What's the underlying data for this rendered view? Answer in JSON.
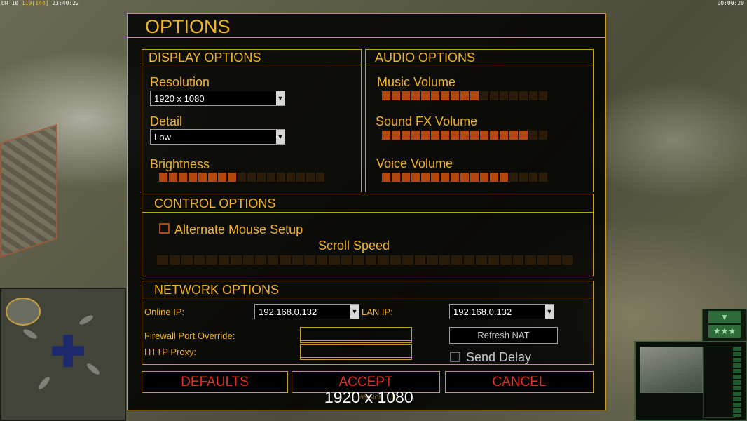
{
  "hud": {
    "top_left_a": "UR 10",
    "top_left_b": "119",
    "top_left_c": "[144]",
    "top_left_time": "23:40:22",
    "top_right_time": "00:00:20"
  },
  "colors": {
    "accent": "#f2b320",
    "border": "#c89a2a",
    "slider_on": "#b5460c",
    "slider_off": "#2a1c08",
    "button_text": "#e0301e",
    "checkbox_border": "#b5460c",
    "checkbox_border_disabled": "#6e6e6e"
  },
  "dialog": {
    "title": "OPTIONS",
    "display": {
      "heading": "DISPLAY OPTIONS",
      "resolution_label": "Resolution",
      "resolution_value": "1920 x 1080",
      "detail_label": "Detail",
      "detail_value": "Low",
      "brightness_label": "Brightness",
      "brightness": {
        "filled": 8,
        "total": 17
      }
    },
    "audio": {
      "heading": "AUDIO OPTIONS",
      "music_label": "Music Volume",
      "music": {
        "filled": 10,
        "total": 17
      },
      "sfx_label": "Sound FX Volume",
      "sfx": {
        "filled": 15,
        "total": 17
      },
      "voice_label": "Voice Volume",
      "voice": {
        "filled": 13,
        "total": 17
      }
    },
    "control": {
      "heading": "CONTROL OPTIONS",
      "alt_mouse_label": "Alternate Mouse Setup",
      "alt_mouse_checked": false,
      "scroll_speed_label": "Scroll Speed",
      "scroll_speed": {
        "filled": 0,
        "total": 34
      }
    },
    "network": {
      "heading": "NETWORK OPTIONS",
      "online_ip_label": "Online IP:",
      "online_ip_value": "192.168.0.132",
      "lan_ip_label": "LAN IP:",
      "lan_ip_value": "192.168.0.132",
      "firewall_label": "Firewall Port Override:",
      "firewall_value": "",
      "http_proxy_label": "HTTP Proxy:",
      "http_proxy_value": "",
      "refresh_nat_label": "Refresh NAT",
      "send_delay_label": "Send Delay",
      "send_delay_checked": false
    },
    "buttons": {
      "defaults": "DEFAULTS",
      "accept": "ACCEPT",
      "cancel": "CANCEL"
    },
    "version_text": "Version 1.8"
  },
  "overlay_resolution": "1920 x 1080",
  "side_panel": {
    "button_label": "★★★"
  }
}
